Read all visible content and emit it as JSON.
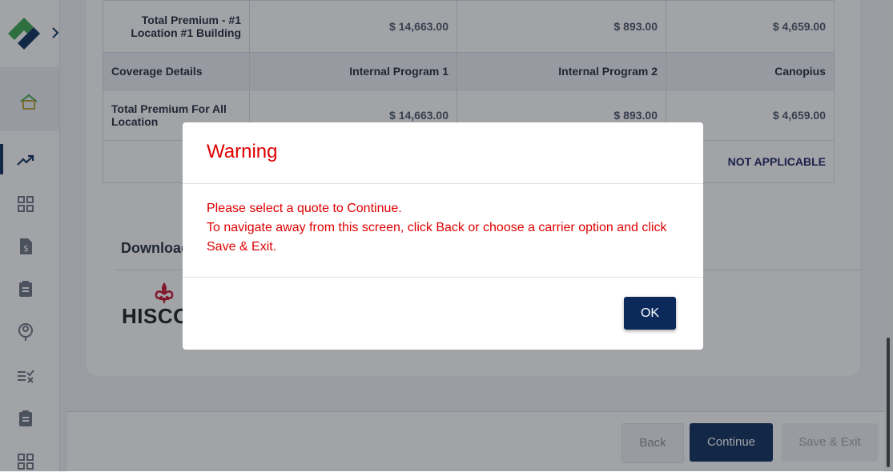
{
  "sidebar": {
    "icons": [
      "logo-icon",
      "chevron-right-icon",
      "home-icon",
      "trending-icon",
      "grid-icon",
      "dollar-document-icon",
      "clipboard-icon",
      "location-badge-icon",
      "checklist-icon",
      "clipboard-icon",
      "grid-icon"
    ]
  },
  "table": {
    "rows": [
      {
        "label": "Total Premium - #1 Location #1 Building",
        "values": [
          "$ 14,663.00",
          "$ 893.00",
          "$ 4,659.00"
        ]
      },
      {
        "label": "Coverage Details",
        "values": [
          "Internal Program 1",
          "Internal Program 2",
          "Canopius"
        ]
      },
      {
        "label": "Total Premium For All Location",
        "values": [
          "$ 14,663.00",
          "$ 893.00",
          "$ 4,659.00"
        ]
      },
      {
        "label": "",
        "values": [
          "",
          "",
          "NOT APPLICABLE"
        ]
      }
    ]
  },
  "download": {
    "title": "Download Q",
    "carrier_logo_text": "HISCOX"
  },
  "footer": {
    "back_label": "Back",
    "continue_label": "Continue",
    "save_exit_label": "Save & Exit"
  },
  "modal": {
    "title": "Warning",
    "line1": "Please select a quote to Continue.",
    "line2": "To navigate away from this screen, click Back or choose a carrier option and click Save & Exit.",
    "ok_label": "OK"
  },
  "colors": {
    "primary": "#0b2a5b",
    "warning_text": "#e00000",
    "logo_green": "#3aa64a",
    "logo_navy": "#0b2a5b",
    "hiscox_red": "#c8102e"
  }
}
